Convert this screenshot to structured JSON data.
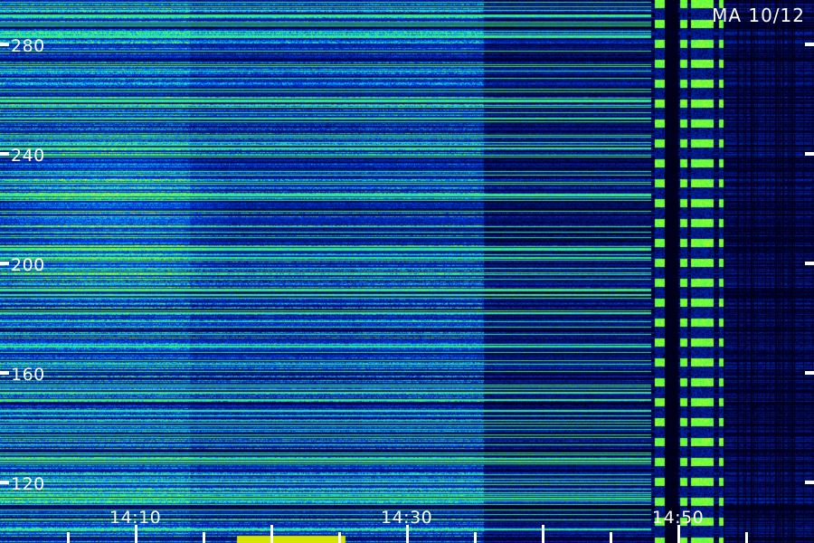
{
  "station_label": "MA 10/12",
  "y_axis": {
    "ticks": [
      "280",
      "240",
      "200",
      "160",
      "120"
    ],
    "values": [
      280,
      240,
      200,
      160,
      120
    ]
  },
  "x_axis": {
    "ticks": [
      "14:10",
      "14:30",
      "14:50"
    ]
  },
  "colors": {
    "background": "#000010",
    "low": "#00008c",
    "mid": "#1e90ff",
    "high": "#33ff33",
    "peak": "#ffff00",
    "tick": "#ffffff"
  }
}
